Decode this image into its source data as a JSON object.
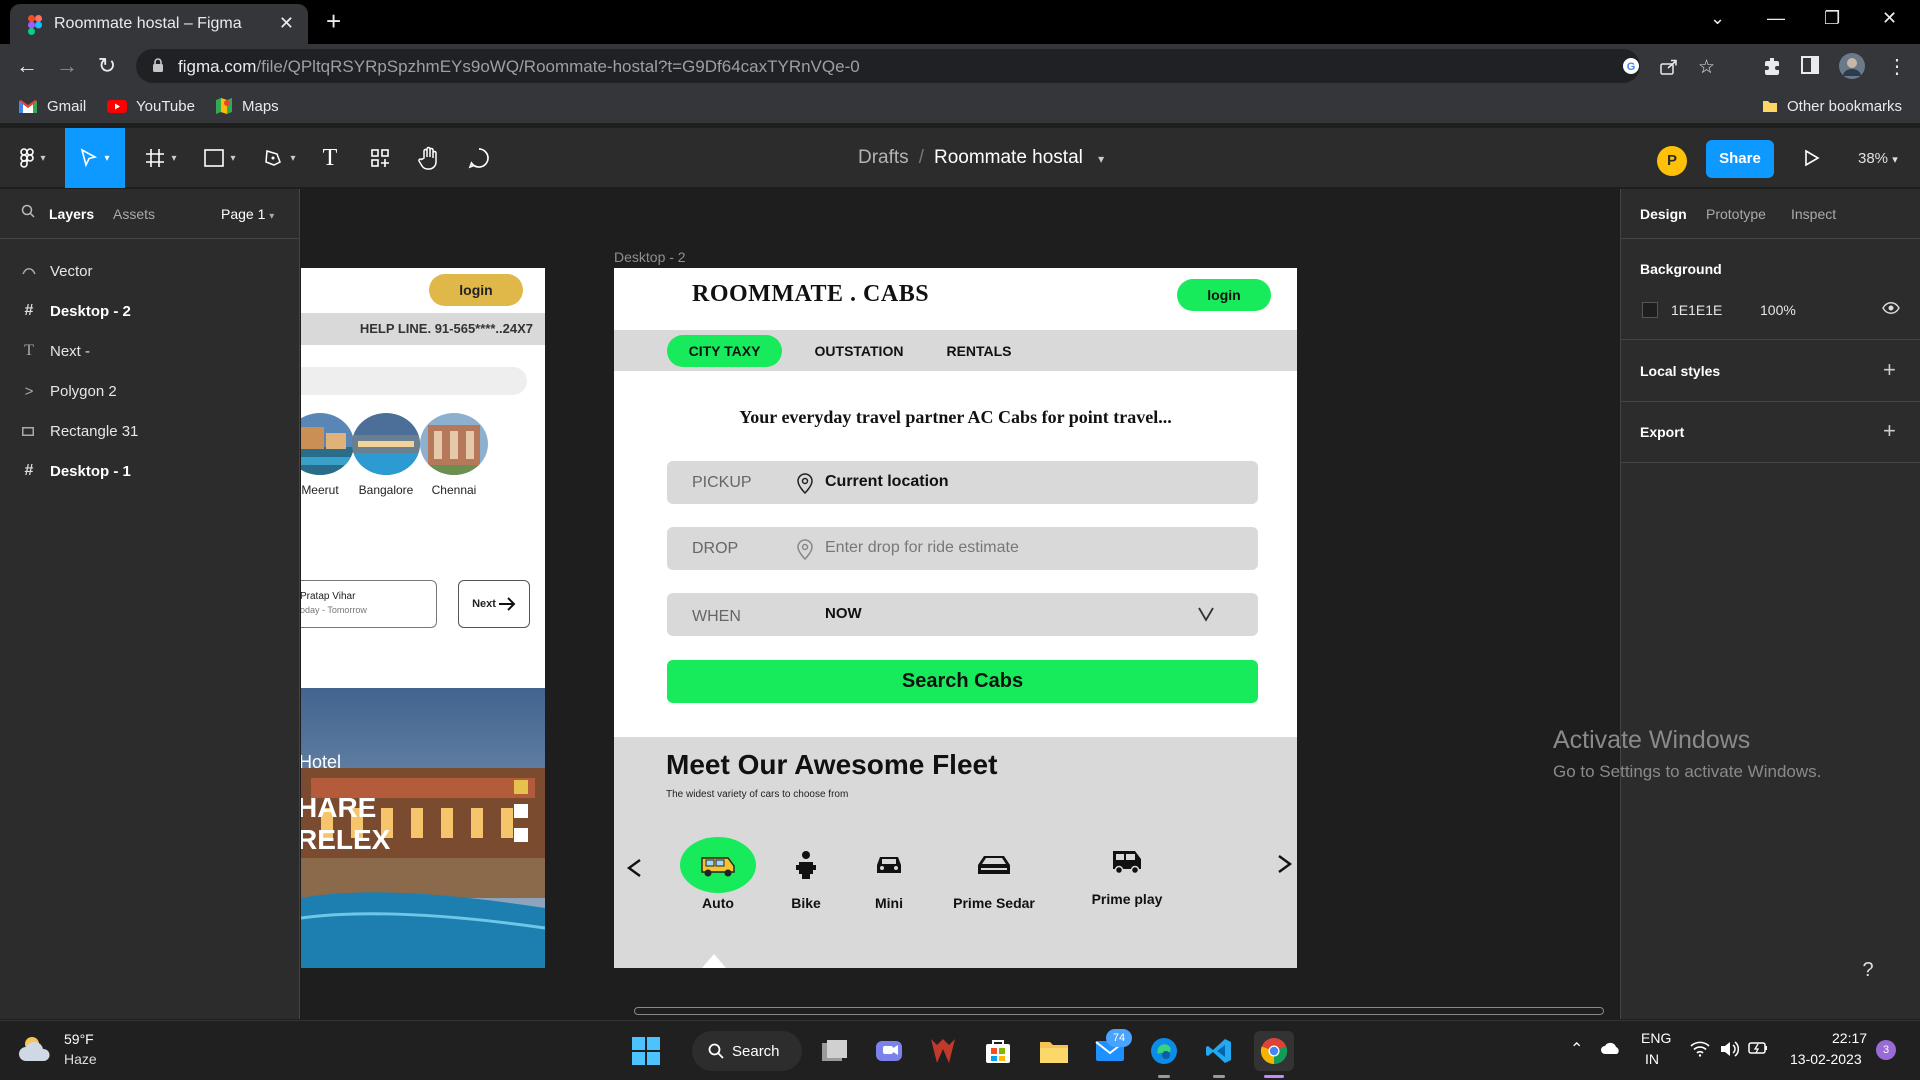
{
  "browser": {
    "tab_title": "Roommate hostal – Figma",
    "url_host": "figma.com",
    "url_path": "/file/QPltqRSYRpSpzhmEYs9oWQ/Roommate-hostal?t=G9Df64caxTYRnVQe-0",
    "bookmarks": [
      "Gmail",
      "YouTube",
      "Maps"
    ],
    "other_bookmarks": "Other bookmarks"
  },
  "figma": {
    "breadcrumb_drafts": "Drafts",
    "breadcrumb_sep": "/",
    "file_name": "Roommate hostal",
    "avatar_initial": "P",
    "share_label": "Share",
    "zoom": "38%",
    "left_tabs": {
      "layers": "Layers",
      "assets": "Assets",
      "page": "Page 1"
    },
    "layers": [
      {
        "icon": "vector",
        "label": "Vector"
      },
      {
        "icon": "frame",
        "label": "Desktop - 2"
      },
      {
        "icon": "text",
        "label": "Next -"
      },
      {
        "icon": "polygon",
        "label": "Polygon 2"
      },
      {
        "icon": "rectangle",
        "label": "Rectangle 31"
      },
      {
        "icon": "frame",
        "label": "Desktop - 1"
      }
    ],
    "right_tabs": {
      "design": "Design",
      "prototype": "Prototype",
      "inspect": "Inspect"
    },
    "background_label": "Background",
    "background_hex": "1E1E1E",
    "background_opacity": "100%",
    "local_styles": "Local styles",
    "export": "Export"
  },
  "desktop1": {
    "login": "login",
    "helpline": "HELP LINE. 91-565****..24X7",
    "cities": [
      "Meerut",
      "Bangalore",
      "Chennai"
    ],
    "date_place": "Pratap Vihar",
    "date_range": "oday - Tomorrow",
    "next_label": "Next",
    "hotel_word": "Hotel",
    "hotel_line1": "HARE",
    "hotel_line2": "RELEX"
  },
  "desktop2": {
    "frame_label": "Desktop - 2",
    "brand": "ROOMMATE . CABS",
    "login": "login",
    "tabs": [
      "CITY TAXY",
      "OUTSTATION",
      "RENTALS"
    ],
    "tagline": "Your everyday travel partner  AC Cabs for point travel...",
    "pickup_label": "PICKUP",
    "pickup_value": "Current location",
    "drop_label": "DROP",
    "drop_placeholder": "Enter drop for ride estimate",
    "when_label": "WHEN",
    "when_value": "NOW",
    "search_button": "Search  Cabs",
    "fleet_title": "Meet Our Awesome Fleet",
    "fleet_subtitle": "The widest variety of cars to choose from",
    "vehicles": [
      "Auto",
      "Bike",
      "Mini",
      "Prime Sedar",
      "Prime play"
    ]
  },
  "watermark": {
    "line1": "Activate Windows",
    "line2": "Go to Settings to activate Windows."
  },
  "taskbar": {
    "temperature": "59°F",
    "weather": "Haze",
    "search": "Search",
    "mail_badge": "74",
    "lang1": "ENG",
    "lang2": "IN",
    "time": "22:17",
    "date": "13-02-2023",
    "notifications": "3"
  },
  "colors": {
    "figma_blue": "#0d99ff",
    "accent_green": "#17ea5b",
    "login_gold": "#e0b84a",
    "panel_bg": "#2c2c2c",
    "canvas_bg": "#1e1e1e"
  }
}
